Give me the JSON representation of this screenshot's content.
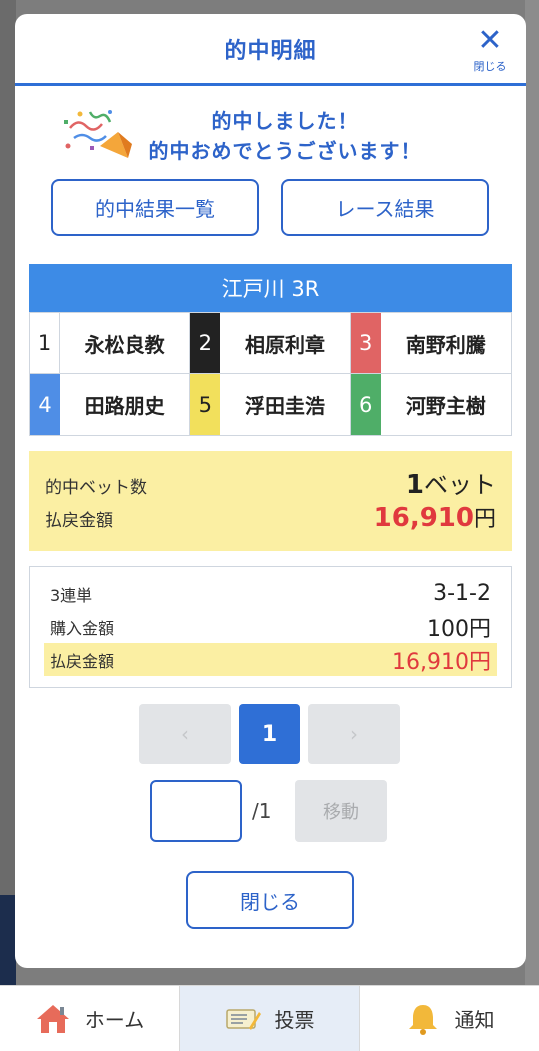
{
  "modal": {
    "title": "的中明細",
    "close_label": "閉じる",
    "congrats_line1": "的中しました！",
    "congrats_line2": "的中おめでとうございます！",
    "buttons": [
      "的中結果一覧",
      "レース結果"
    ]
  },
  "race": {
    "title": "江戸川 3R",
    "racers": [
      {
        "lane": "1",
        "name": "永松良教"
      },
      {
        "lane": "2",
        "name": "相原利章"
      },
      {
        "lane": "3",
        "name": "南野利騰"
      },
      {
        "lane": "4",
        "name": "田路朋史"
      },
      {
        "lane": "5",
        "name": "浮田圭浩"
      },
      {
        "lane": "6",
        "name": "河野主樹"
      }
    ],
    "lane_colors": [
      "#ffffff",
      "#222222",
      "#e06464",
      "#4f8ee6",
      "#f2e05c",
      "#4fae68"
    ]
  },
  "summary": {
    "bets_label": "的中ベット数",
    "bets_count": "1",
    "bets_unit": "ベット",
    "payout_label": "払戻金額",
    "payout_value": "16,910",
    "payout_unit": "円"
  },
  "detail": {
    "bet_type": "3連単",
    "combination": "3-1-2",
    "purchase_label": "購入金額",
    "purchase_value": "100円",
    "payout_label": "払戻金額",
    "payout_value": "16,910円"
  },
  "pager": {
    "prev": "‹",
    "current": "1",
    "next": "›",
    "total": "/1",
    "move_label": "移動"
  },
  "footer_close": "閉じる",
  "tabbar": {
    "home": "ホーム",
    "vote": "投票",
    "notify": "通知"
  },
  "colors": {
    "accent": "#2d63c9",
    "race_header": "#3d8be6",
    "highlight": "#fbefa3",
    "payout": "#e0393e"
  }
}
